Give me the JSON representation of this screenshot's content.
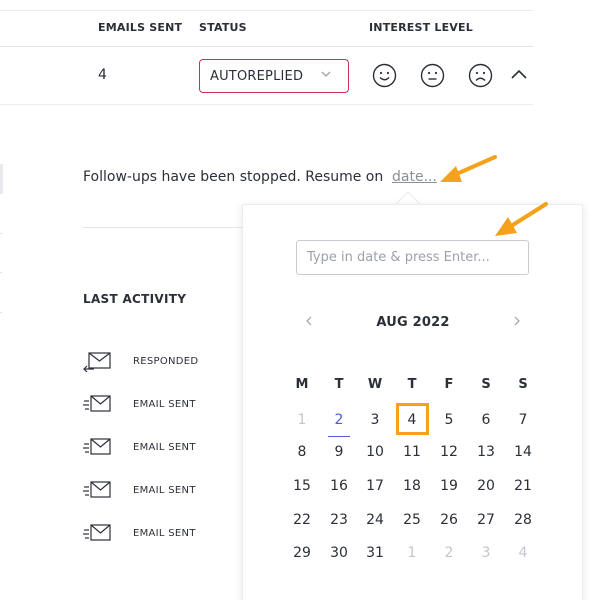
{
  "table": {
    "headers": {
      "emails_sent": "EMAILS SENT",
      "status": "STATUS",
      "interest_level": "INTEREST LEVEL"
    },
    "row": {
      "emails_sent": "4",
      "status": "AUTOREPLIED"
    }
  },
  "followup": {
    "text": "Follow-ups have been stopped. Resume on",
    "date_link": "date..."
  },
  "last_activity": {
    "title": "LAST ACTIVITY",
    "items": [
      {
        "label": "RESPONDED",
        "icon": "reply-mail-icon"
      },
      {
        "label": "EMAIL SENT",
        "icon": "sent-mail-icon"
      },
      {
        "label": "EMAIL SENT",
        "icon": "sent-mail-icon"
      },
      {
        "label": "EMAIL SENT",
        "icon": "sent-mail-icon"
      },
      {
        "label": "EMAIL SENT",
        "icon": "sent-mail-icon"
      }
    ]
  },
  "calendar": {
    "input_placeholder": "Type in date & press Enter...",
    "month": "AUG 2022",
    "weekdays": [
      "M",
      "T",
      "W",
      "T",
      "F",
      "S",
      "S"
    ],
    "weeks": [
      [
        {
          "d": "1",
          "m": true
        },
        {
          "d": "2",
          "today": true
        },
        {
          "d": "3"
        },
        {
          "d": "4",
          "selected": true
        },
        {
          "d": "5"
        },
        {
          "d": "6"
        },
        {
          "d": "7"
        }
      ],
      [
        {
          "d": "8"
        },
        {
          "d": "9"
        },
        {
          "d": "10"
        },
        {
          "d": "11"
        },
        {
          "d": "12"
        },
        {
          "d": "13"
        },
        {
          "d": "14"
        }
      ],
      [
        {
          "d": "15"
        },
        {
          "d": "16"
        },
        {
          "d": "17"
        },
        {
          "d": "18"
        },
        {
          "d": "19"
        },
        {
          "d": "20"
        },
        {
          "d": "21"
        }
      ],
      [
        {
          "d": "22"
        },
        {
          "d": "23"
        },
        {
          "d": "24"
        },
        {
          "d": "25"
        },
        {
          "d": "26"
        },
        {
          "d": "27"
        },
        {
          "d": "28"
        }
      ],
      [
        {
          "d": "29"
        },
        {
          "d": "30"
        },
        {
          "d": "31"
        },
        {
          "d": "1",
          "m": true
        },
        {
          "d": "2",
          "m": true
        },
        {
          "d": "3",
          "m": true
        },
        {
          "d": "4",
          "m": true
        }
      ]
    ]
  },
  "colors": {
    "status_border": "#d32f4f",
    "today": "#4f5bd5",
    "selected_border": "#f5a11a",
    "annotation_arrow": "#f5a11a"
  }
}
